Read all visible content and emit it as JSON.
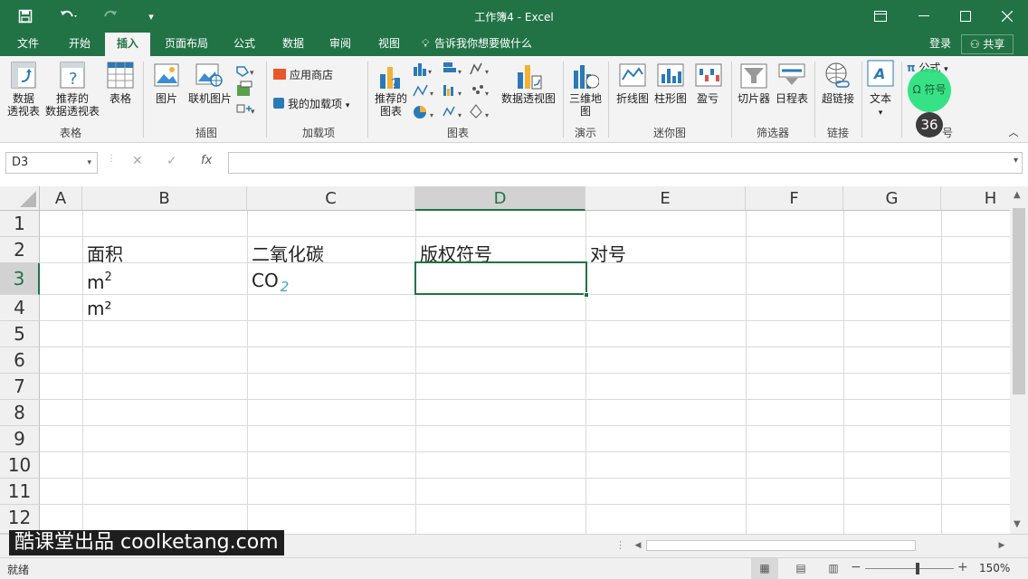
{
  "window": {
    "title": "工作簿4 - Excel"
  },
  "tabs": [
    "文件",
    "开始",
    "插入",
    "页面布局",
    "公式",
    "数据",
    "审阅",
    "视图"
  ],
  "tell_me": "告诉我你想要做什么",
  "account": {
    "login": "登录",
    "share": "共享"
  },
  "ribbon": {
    "groups": {
      "tables": {
        "label": "表格",
        "pivot": "数据\n透视表",
        "rec_pivot": "推荐的\n数据透视表",
        "table": "表格"
      },
      "illustrations": {
        "label": "插图",
        "pictures": "图片",
        "online_pictures": "联机图片"
      },
      "addins": {
        "label": "加载项",
        "store": "应用商店",
        "my_addins": "我的加载项"
      },
      "charts": {
        "label": "图表",
        "rec_charts": "推荐的\n图表",
        "pivot_chart": "数据透视图"
      },
      "tours": {
        "label": "演示",
        "map3d": "三维地\n图"
      },
      "sparklines": {
        "label": "迷你图",
        "line": "折线图",
        "column": "柱形图",
        "winloss": "盈亏"
      },
      "filters": {
        "label": "筛选器",
        "slicer": "切片器",
        "timeline": "日程表"
      },
      "links": {
        "label": "链接",
        "hyperlink": "超链接"
      },
      "text": {
        "label": "文本",
        "text": "文本"
      },
      "symbols": {
        "label": "符号",
        "equation": "公式",
        "symbol": "符号",
        "badge": "36"
      }
    }
  },
  "formula_bar": {
    "name_box": "D3",
    "fx": "fx",
    "value": ""
  },
  "sheet": {
    "columns": [
      "A",
      "B",
      "C",
      "D",
      "E",
      "F",
      "G",
      "H"
    ],
    "selected_column": "D",
    "rows": [
      "1",
      "2",
      "3",
      "4",
      "5",
      "6",
      "7",
      "8",
      "9",
      "10",
      "11",
      "12"
    ],
    "selected_row": "3",
    "selected_cell": "D3",
    "cells": {
      "B2": "面积",
      "C2": "二氧化碳",
      "D2": "版权符号",
      "E2": "对号",
      "B3_base": "m",
      "B3_sup": "2",
      "C3_base": "CO",
      "C3_sub": "2",
      "B4": "m²"
    }
  },
  "status": {
    "ready": "就绪",
    "zoom": "150%"
  },
  "watermark": "酷课堂出品 coolketang.com",
  "colors": {
    "accent": "#217346",
    "subscript_color": "#3aa6c9",
    "highlight": "#22e07a"
  }
}
